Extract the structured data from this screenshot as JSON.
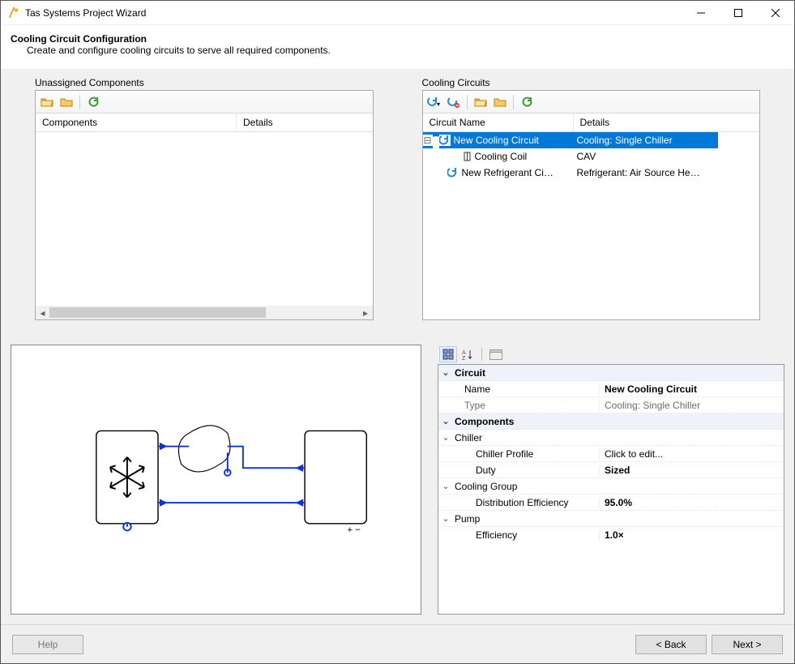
{
  "window": {
    "title": "Tas Systems Project Wizard"
  },
  "header": {
    "title": "Cooling Circuit Configuration",
    "subtitle": "Create and configure cooling circuits to serve all required components."
  },
  "unassigned": {
    "label": "Unassigned Components",
    "columns": {
      "c1": "Components",
      "c2": "Details"
    }
  },
  "circuits": {
    "label": "Cooling Circuits",
    "columns": {
      "c1": "Circuit Name",
      "c2": "Details"
    },
    "rows": [
      {
        "name": "New Cooling Circuit",
        "detail": "Cooling: Single Chiller",
        "selected": true,
        "level": 0,
        "expandable": true
      },
      {
        "name": "Cooling Coil",
        "detail": "CAV",
        "selected": false,
        "level": 1,
        "expandable": false
      },
      {
        "name": "New Refrigerant Ci…",
        "detail": "Refrigerant: Air Source He…",
        "selected": false,
        "level": 0,
        "expandable": false
      }
    ]
  },
  "propgrid": {
    "cat_circuit": "Circuit",
    "name_key": "Name",
    "name_val": "New Cooling Circuit",
    "type_key": "Type",
    "type_val": "Cooling: Single Chiller",
    "cat_components": "Components",
    "chiller_key": "Chiller",
    "chiller_profile_key": "Chiller Profile",
    "chiller_profile_val": "Click to edit...",
    "duty_key": "Duty",
    "duty_val": "Sized",
    "cooling_group_key": "Cooling Group",
    "dist_eff_key": "Distribution Efficiency",
    "dist_eff_val": "95.0%",
    "pump_key": "Pump",
    "pump_eff_key": "Efficiency",
    "pump_eff_val": "1.0×"
  },
  "footer": {
    "help": "Help",
    "back": "< Back",
    "next": "Next >"
  }
}
